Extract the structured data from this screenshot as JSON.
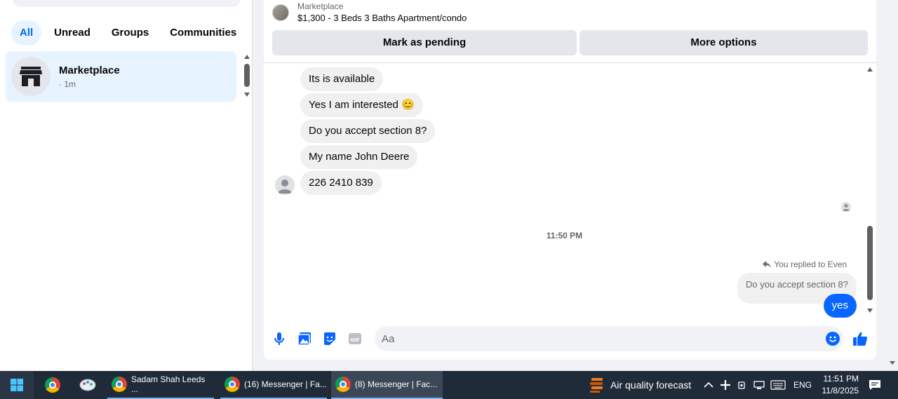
{
  "sidebar": {
    "filters": [
      {
        "label": "All",
        "active": true
      },
      {
        "label": "Unread",
        "active": false
      },
      {
        "label": "Groups",
        "active": false
      },
      {
        "label": "Communities",
        "active": false
      }
    ],
    "conversations": [
      {
        "name": "Marketplace",
        "time": "· 1m",
        "icon": "store-icon"
      }
    ]
  },
  "chat": {
    "listing": {
      "label": "Marketplace",
      "title": "$1,300 - 3 Beds 3 Baths Apartment/condo"
    },
    "actions": {
      "pending": "Mark as pending",
      "more": "More options"
    },
    "incoming": [
      "Its is available",
      "Yes I am interested 😊",
      "Do you accept section 8?",
      "My name John Deere",
      "226 2410 839"
    ],
    "timestamp": "11:50 PM",
    "reply_note": "You replied to Even",
    "reply_quote": "Do you accept section 8?",
    "outgoing": "yes",
    "composer": {
      "placeholder": "Aa"
    },
    "accent_color": "#0866ff"
  },
  "taskbar": {
    "apps": [
      {
        "label": "Sadam Shah Leeds ...",
        "active": false
      },
      {
        "label": "(16) Messenger | Fa...",
        "active": false
      },
      {
        "label": "(8) Messenger | Fac...",
        "active": true
      }
    ],
    "weather": "Air quality forecast",
    "language": "ENG",
    "time": "11:51 PM",
    "date": "11/8/2025"
  }
}
